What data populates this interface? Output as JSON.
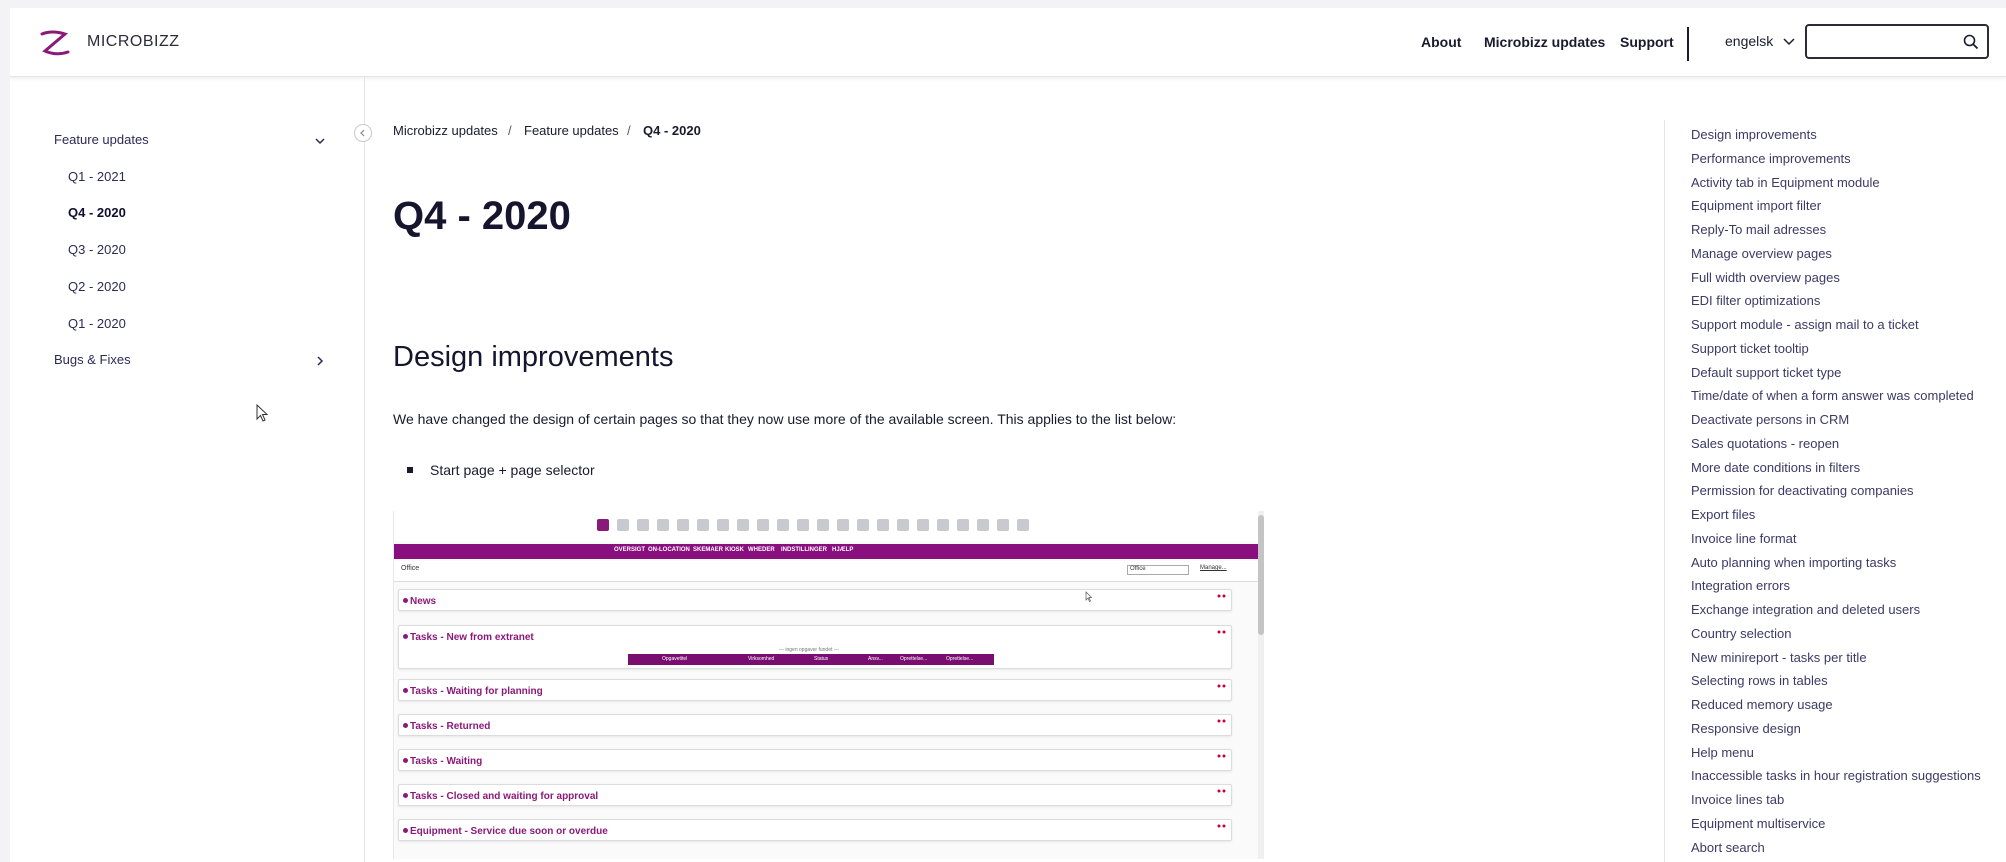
{
  "header": {
    "logo_text": "MICROBIZZ",
    "nav": [
      "About",
      "Microbizz updates",
      "Support"
    ],
    "language": "engelsk",
    "search_value": "",
    "search_icon": "search-icon",
    "accent_color": "#8a1a7a"
  },
  "sidebar": {
    "sections": [
      {
        "label": "Feature updates",
        "expanded": true,
        "icon": "chevron-down-icon"
      },
      {
        "label": "Bugs & Fixes",
        "expanded": false,
        "icon": "chevron-right-icon"
      }
    ],
    "items": [
      {
        "label": "Q1 - 2021",
        "active": false
      },
      {
        "label": "Q4 - 2020",
        "active": true
      },
      {
        "label": "Q3 - 2020",
        "active": false
      },
      {
        "label": "Q2 - 2020",
        "active": false
      },
      {
        "label": "Q1 - 2020",
        "active": false
      }
    ]
  },
  "breadcrumb": [
    "Microbizz updates",
    "Feature updates",
    "Q4 - 2020"
  ],
  "breadcrumb_separator": "/",
  "main": {
    "title": "Q4 - 2020",
    "section_title": "Design improvements",
    "paragraph": "We have changed the design of certain pages so that they now use more of the available screen. This applies to the list below:",
    "bullets": [
      "Start page + page selector"
    ]
  },
  "embedded_screenshot": {
    "menu": [
      "OVERSIGT",
      "ON-LOCATION",
      "SKEMAER",
      "KIOSK",
      "WHEDER",
      "INDSTILLINGER",
      "HJÆLP"
    ],
    "office_label": "Office",
    "office_select": "Office",
    "manage_label": "Manage...",
    "panels": [
      "News",
      "Tasks - New from extranet",
      "Tasks - Waiting for planning",
      "Tasks - Returned",
      "Tasks - Waiting",
      "Tasks - Closed and waiting for approval",
      "Equipment - Service due soon or overdue"
    ],
    "table_caption": "--- ingen opgaver fundet ---",
    "table_columns": [
      "Opgavetitel",
      "Virksomhed",
      "Status",
      "Ansv...",
      "Oprettelse...",
      "Oprettelse..."
    ]
  },
  "toc": [
    "Design improvements",
    "Performance improvements",
    "Activity tab in Equipment module",
    "Equipment import filter",
    "Reply-To mail adresses",
    "Manage overview pages",
    "Full width overview pages",
    "EDI filter optimizations",
    "Support module - assign mail to a ticket",
    "Support ticket tooltip",
    "Default support ticket type",
    "Time/date of when a form answer was completed",
    "Deactivate persons in CRM",
    "Sales quotations - reopen",
    "More date conditions in filters",
    "Permission for deactivating companies",
    "Export files",
    "Invoice line format",
    "Auto planning when importing tasks",
    "Integration errors",
    "Exchange integration and deleted users",
    "Country selection",
    "New minireport - tasks per title",
    "Selecting rows in tables",
    "Reduced memory usage",
    "Responsive design",
    "Help menu",
    "Inaccessible tasks in hour registration suggestions",
    "Invoice lines tab",
    "Equipment multiservice",
    "Abort search"
  ]
}
